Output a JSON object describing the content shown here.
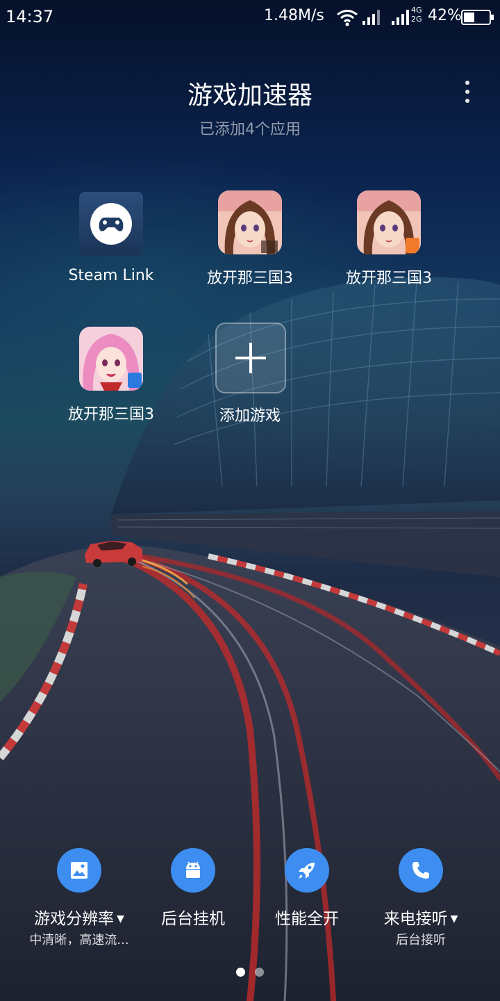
{
  "status_bar": {
    "time": "14:37",
    "speed": "1.48M/s",
    "network_top": "4G",
    "network_bottom": "2G",
    "battery": "42%",
    "battery_level": 0.42
  },
  "header": {
    "title": "游戏加速器",
    "subtitle": "已添加4个应用"
  },
  "apps": [
    {
      "label": "Steam Link",
      "icon": "steam-link-icon",
      "accent": "#2a4a77"
    },
    {
      "label": "放开那三国3",
      "icon": "game-portrait-icon",
      "accent": "#b8744f"
    },
    {
      "label": "放开那三国3",
      "icon": "game-portrait-icon",
      "accent": "#b8744f"
    },
    {
      "label": "放开那三国3",
      "icon": "game-portrait-pink-icon",
      "accent": "#e79ac6"
    }
  ],
  "add_game": {
    "label": "添加游戏",
    "icon": "plus-icon"
  },
  "tools": [
    {
      "label": "游戏分辨率",
      "sub": "中清晰，高速流...",
      "icon": "image-icon",
      "has_dropdown": true
    },
    {
      "label": "后台挂机",
      "sub": "",
      "icon": "android-icon",
      "has_dropdown": false
    },
    {
      "label": "性能全开",
      "sub": "",
      "icon": "rocket-icon",
      "has_dropdown": false
    },
    {
      "label": "来电接听",
      "sub": "后台接听",
      "icon": "phone-icon",
      "has_dropdown": true
    }
  ],
  "tool_caret": "▼",
  "pages": {
    "count": 2,
    "active": 1
  },
  "colors": {
    "accent": "#3d8ef0",
    "background_top": "#06112a",
    "background_bottom": "#1b1f2d"
  }
}
